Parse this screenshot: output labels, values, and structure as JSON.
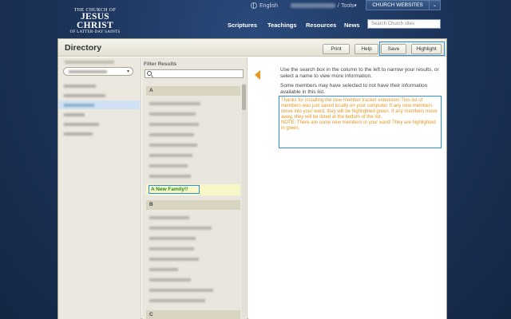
{
  "brand": {
    "line1": "The Church of",
    "line2": "JESUS CHRIST",
    "line3": "of Latter-day Saints"
  },
  "utility": {
    "language": "English",
    "tools": "Tools",
    "church_websites": "CHURCH WEBSITES"
  },
  "nav": {
    "scriptures": "Scriptures",
    "teachings": "Teachings",
    "resources": "Resources",
    "news": "News"
  },
  "search": {
    "placeholder": "Search Church sites"
  },
  "page": {
    "title": "Directory",
    "buttons": {
      "print": "Print",
      "help": "Help",
      "save": "Save",
      "highlight": "Highlight"
    }
  },
  "middle": {
    "filter_label": "Filter Results",
    "sections": [
      "A",
      "B",
      "C"
    ],
    "new_family": "A New Family!!"
  },
  "right": {
    "info1": "Use the search box in the column to the left to narrow your results, or select a name to view more information.",
    "info2": "Some members may have selected to not have their information available in this list.",
    "notice1": "Thanks for installing the new member tracker extension! This list of members was just saved locally on your computer. If any new members move into your ward, they will be highlighted green. If any members move away, they will be listed at the bottom of the list.",
    "notice2": "NOTE: There are some new members in your ward! They are highlighted in green."
  },
  "colors": {
    "accent_orange": "#e8951e",
    "highlight_green": "#2a8a2a",
    "selection_blue": "#2d8fd9"
  }
}
